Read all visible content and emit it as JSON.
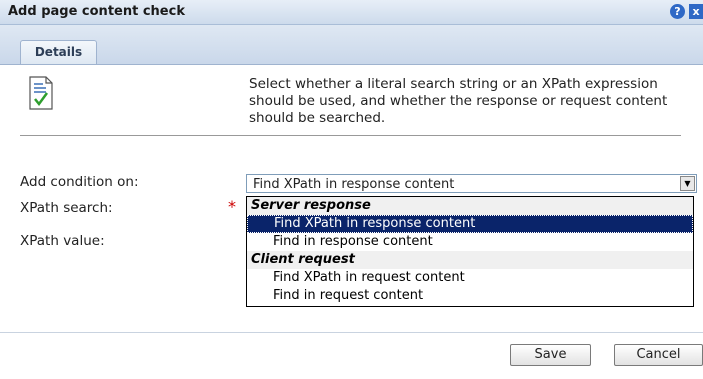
{
  "dialog": {
    "title": "Add page content check",
    "help_glyph": "?",
    "close_glyph": "x"
  },
  "tabs": [
    {
      "label": "Details",
      "active": true
    }
  ],
  "description": "Select whether a literal search string or an XPath expression should be used, and whether the response or request content should be searched.",
  "form": {
    "condition_label": "Add condition on:",
    "xpath_search_label": "XPath search:",
    "xpath_value_label": "XPath value:",
    "required_marker": "*",
    "selected_value": "Find XPath in response content"
  },
  "dropdown": {
    "groups": [
      {
        "label": "Server response",
        "options": [
          "Find XPath in response content",
          "Find in response content"
        ]
      },
      {
        "label": "Client request",
        "options": [
          "Find XPath in request content",
          "Find in request content"
        ]
      }
    ],
    "highlighted": "Find XPath in response content"
  },
  "buttons": {
    "save": "Save",
    "cancel": "Cancel"
  },
  "colors": {
    "title_bar": "#cddbec",
    "highlight": "#0a246a",
    "required": "#cc0000",
    "icon_check": "#2e9e2e"
  },
  "icons": {
    "help": "help-icon",
    "close": "close-icon",
    "document": "document-check-icon",
    "dropdown_arrow": "chevron-down-icon"
  }
}
